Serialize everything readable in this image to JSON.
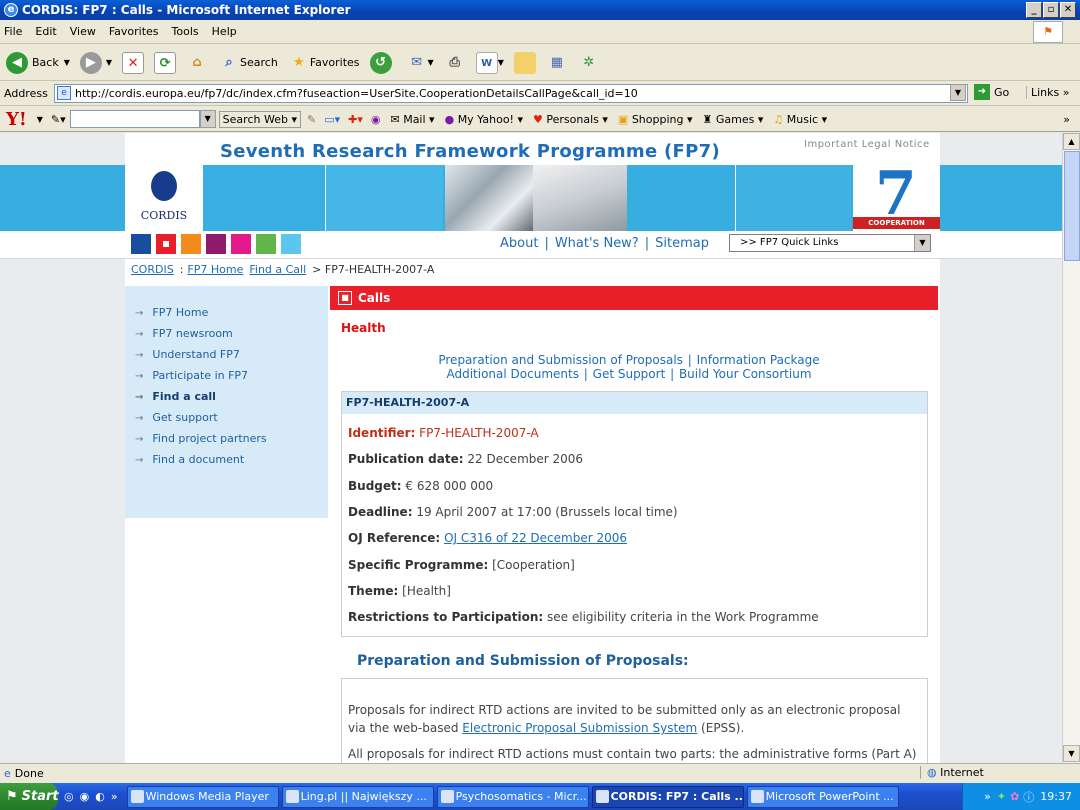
{
  "window": {
    "title": "CORDIS: FP7 : Calls - Microsoft Internet Explorer"
  },
  "menu": [
    "File",
    "Edit",
    "View",
    "Favorites",
    "Tools",
    "Help"
  ],
  "toolbar": {
    "back": "Back",
    "search": "Search",
    "favorites": "Favorites"
  },
  "address": {
    "label": "Address",
    "url": "http://cordis.europa.eu/fp7/dc/index.cfm?fuseaction=UserSite.CooperationDetailsCallPage&call_id=10",
    "go": "Go",
    "links": "Links"
  },
  "yahoo": {
    "search_btn": "Search Web",
    "mail": "Mail",
    "my_yahoo": "My Yahoo!",
    "personals": "Personals",
    "shopping": "Shopping",
    "games": "Games",
    "music": "Music"
  },
  "site": {
    "title": "Seventh Research Framework Programme (FP7)",
    "legal": "Important Legal Notice",
    "logo_text": "CORDIS",
    "coop_label": "COOPERATION",
    "coop_number": "7",
    "top_links": [
      "About",
      "What's New?",
      "Sitemap"
    ],
    "quick_links": ">> FP7 Quick Links",
    "colors": [
      "#1a4d9e",
      "#e8202a",
      "#f28a1c",
      "#8e1a6c",
      "#e21a8a",
      "#62b54a",
      "#5bc6ee"
    ]
  },
  "breadcrumb": {
    "items": [
      "CORDIS",
      "FP7 Home",
      "Find a Call"
    ],
    "current": "> FP7-HEALTH-2007-A",
    "sep": ":"
  },
  "leftnav": [
    "FP7 Home",
    "FP7 newsroom",
    "Understand FP7",
    "Participate in FP7",
    "Find a call",
    "Get support",
    "Find project partners",
    "Find a document"
  ],
  "main": {
    "section": "Calls",
    "heading": "Health",
    "links1": [
      "Preparation and Submission of Proposals",
      "Information Package"
    ],
    "links2": [
      "Additional Documents",
      "Get Support",
      "Build Your Consortium"
    ],
    "call": {
      "title": "FP7-HEALTH-2007-A",
      "identifier_label": "Identifier:",
      "identifier": "FP7-HEALTH-2007-A",
      "pub_label": "Publication date:",
      "pub": "22 December 2006",
      "budget_label": "Budget:",
      "budget": "€ 628 000 000",
      "deadline_label": "Deadline:",
      "deadline": "19 April 2007 at 17:00 (Brussels local time)",
      "oj_label": "OJ Reference:",
      "oj": "OJ C316 of 22 December 2006",
      "prog_label": "Specific Programme:",
      "prog": "[Cooperation]",
      "theme_label": "Theme:",
      "theme": "[Health]",
      "restr_label": "Restrictions to Participation:",
      "restr": "see eligibility criteria in the Work Programme"
    },
    "prep_heading": "Preparation and Submission of Proposals:",
    "prep_p1a": "Proposals for indirect RTD actions are invited to be submitted only as an electronic proposal via the web-based ",
    "prep_p1_link": "Electronic Proposal Submission System",
    "prep_p1b": " (EPSS).",
    "prep_p2": "All proposals for indirect RTD actions must contain two parts: the administrative forms (Part A)"
  },
  "status": {
    "left": "Done",
    "zone": "Internet"
  },
  "taskbar": {
    "start": "Start",
    "more": "»",
    "buttons": [
      "Windows Media Player",
      "Ling.pl || Największy ...",
      "Psychosomatics - Micr...",
      "CORDIS: FP7 : Calls ...",
      "Microsoft PowerPoint ..."
    ],
    "active": 3,
    "clock": "19:37"
  }
}
